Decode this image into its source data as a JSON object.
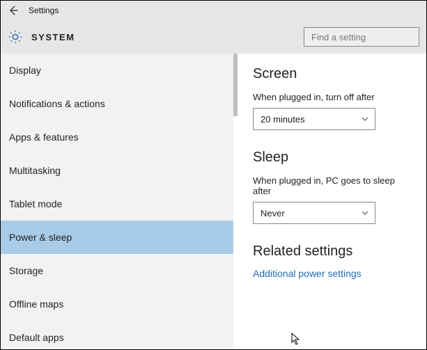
{
  "titlebar": {
    "title": "Settings"
  },
  "header": {
    "system_label": "SYSTEM",
    "search_placeholder": "Find a setting"
  },
  "sidebar": {
    "items": [
      {
        "label": "Display",
        "selected": false
      },
      {
        "label": "Notifications & actions",
        "selected": false
      },
      {
        "label": "Apps & features",
        "selected": false
      },
      {
        "label": "Multitasking",
        "selected": false
      },
      {
        "label": "Tablet mode",
        "selected": false
      },
      {
        "label": "Power & sleep",
        "selected": true
      },
      {
        "label": "Storage",
        "selected": false
      },
      {
        "label": "Offline maps",
        "selected": false
      },
      {
        "label": "Default apps",
        "selected": false
      }
    ]
  },
  "main": {
    "screen": {
      "title": "Screen",
      "plugged_label": "When plugged in, turn off after",
      "plugged_value": "20 minutes"
    },
    "sleep": {
      "title": "Sleep",
      "plugged_label": "When plugged in, PC goes to sleep after",
      "plugged_value": "Never"
    },
    "related": {
      "title": "Related settings",
      "link": "Additional power settings"
    }
  }
}
